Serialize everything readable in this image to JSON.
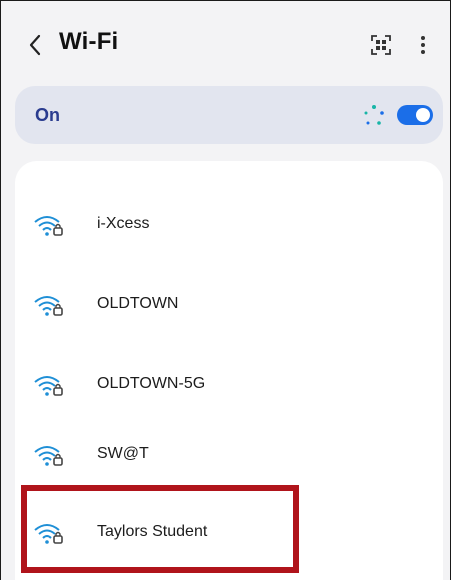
{
  "header": {
    "back_icon": "chevron-left-icon",
    "title": "Wi-Fi",
    "qr_icon": "qr-scan-icon",
    "more_icon": "more-vertical-icon"
  },
  "wifi_toggle": {
    "label": "On",
    "state": "on",
    "scanning_icon": "scanning-dots-icon",
    "accent_color": "#1b6ee8"
  },
  "networks": [
    {
      "name": "i-Xcess",
      "icon": "wifi-locked-icon"
    },
    {
      "name": "OLDTOWN",
      "icon": "wifi-locked-icon"
    },
    {
      "name": "OLDTOWN-5G",
      "icon": "wifi-locked-icon"
    },
    {
      "name": "SW@T",
      "icon": "wifi-locked-icon"
    },
    {
      "name": "Taylors Student",
      "icon": "wifi-locked-icon",
      "highlighted": true
    }
  ],
  "highlight_color": "#b0141b"
}
